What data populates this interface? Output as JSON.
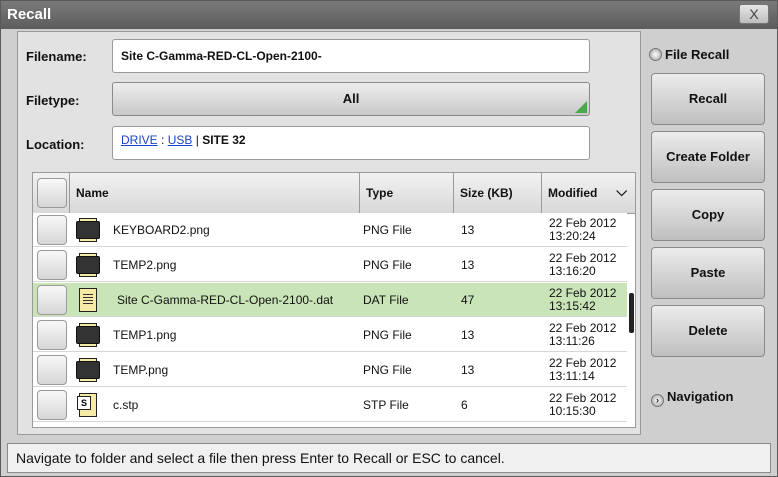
{
  "window": {
    "title": "Recall",
    "close_glyph": "X"
  },
  "form": {
    "filename_label": "Filename:",
    "filename_value": "Site C-Gamma-RED-CL-Open-2100-",
    "filetype_label": "Filetype:",
    "filetype_value": "All",
    "location_label": "Location:",
    "location_drive": "DRIVE",
    "location_sep1": " : ",
    "location_usb": "USB",
    "location_sep2": " | ",
    "location_folder": "SITE 32"
  },
  "table": {
    "headers": {
      "name": "Name",
      "type": "Type",
      "size": "Size (KB)",
      "modified": "Modified"
    },
    "sort_glyph": "⌵",
    "rows": [
      {
        "name": "KEYBOARD2.png",
        "type": "PNG File",
        "size": "13",
        "date": "22 Feb 2012",
        "time": "13:20:24",
        "icon": "png-file-icon"
      },
      {
        "name": "TEMP2.png",
        "type": "PNG File",
        "size": "13",
        "date": "22 Feb 2012",
        "time": "13:16:20",
        "icon": "png-file-icon"
      },
      {
        "name": "Site C-Gamma-RED-CL-Open-2100-.dat",
        "type": "DAT File",
        "size": "47",
        "date": "22 Feb 2012",
        "time": "13:15:42",
        "icon": "dat-file-icon",
        "selected": true
      },
      {
        "name": "TEMP1.png",
        "type": "PNG File",
        "size": "13",
        "date": "22 Feb 2012",
        "time": "13:11:26",
        "icon": "png-file-icon"
      },
      {
        "name": "TEMP.png",
        "type": "PNG File",
        "size": "13",
        "date": "22 Feb 2012",
        "time": "13:11:14",
        "icon": "png-file-icon"
      },
      {
        "name": "c.stp",
        "type": "STP File",
        "size": "6",
        "date": "22 Feb 2012",
        "time": "10:15:30",
        "icon": "stp-file-icon"
      }
    ]
  },
  "sidebar": {
    "mode_label": "File Recall",
    "buttons": [
      "Recall",
      "Create Folder",
      "Copy",
      "Paste",
      "Delete"
    ],
    "navigation_label": "Navigation"
  },
  "status": {
    "text": "Navigate to folder and select a file then press Enter to Recall or ESC to cancel."
  },
  "colors": {
    "selected_row": "#c9e4b7",
    "link": "#1a44c8",
    "titlebar": "#6a6a6a"
  }
}
